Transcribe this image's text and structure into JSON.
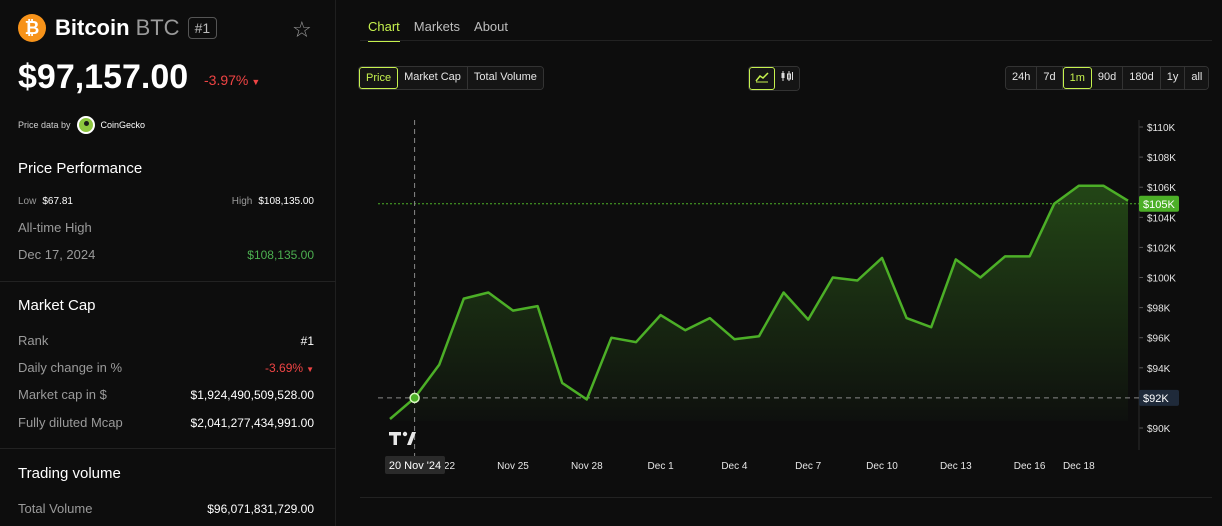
{
  "coin": {
    "logo_glyph": "₿",
    "name": "Bitcoin",
    "symbol": "BTC",
    "rank_badge": "#1",
    "price": "$97,157.00",
    "change": "-3.97%",
    "price_data_label": "Price data by",
    "price_data_source": "CoinGecko",
    "brand_color": "#f7931a"
  },
  "performance": {
    "title": "Price Performance",
    "low_label": "Low",
    "low_value": "$67.81",
    "high_label": "High",
    "high_value": "$108,135.00",
    "ath_label": "All-time High",
    "ath_date": "Dec 17, 2024",
    "ath_value": "$108,135.00"
  },
  "market_cap": {
    "title": "Market Cap",
    "rank_label": "Rank",
    "rank_value": "#1",
    "daily_change_label": "Daily change in %",
    "daily_change_value": "-3.69%",
    "mcap_label": "Market cap in $",
    "mcap_value": "$1,924,490,509,528.00",
    "fdv_label": "Fully diluted Mcap",
    "fdv_value": "$2,041,277,434,991.00"
  },
  "volume": {
    "title": "Trading volume",
    "total_label": "Total Volume",
    "total_value": "$96,071,831,729.00"
  },
  "tabs": [
    {
      "label": "Chart",
      "active": true
    },
    {
      "label": "Markets",
      "active": false
    },
    {
      "label": "About",
      "active": false
    }
  ],
  "metric_buttons": [
    {
      "label": "Price",
      "active": true
    },
    {
      "label": "Market Cap",
      "active": false
    },
    {
      "label": "Total Volume",
      "active": false
    }
  ],
  "chart_type_buttons": [
    {
      "icon": "line-chart-icon",
      "active": true
    },
    {
      "icon": "candlestick-icon",
      "active": false
    }
  ],
  "range_buttons": [
    {
      "label": "24h",
      "active": false
    },
    {
      "label": "7d",
      "active": false
    },
    {
      "label": "1m",
      "active": true
    },
    {
      "label": "90d",
      "active": false
    },
    {
      "label": "180d",
      "active": false
    },
    {
      "label": "1y",
      "active": false
    },
    {
      "label": "all",
      "active": false
    }
  ],
  "chart_data": {
    "type": "area",
    "x_start_label": "20 Nov '24",
    "x_ticks": [
      "Nov 22",
      "Nov 25",
      "Nov 28",
      "Dec 1",
      "Dec 4",
      "Dec 7",
      "Dec 10",
      "Dec 13",
      "Dec 16",
      "Dec 18"
    ],
    "y_ticks": [
      "$110K",
      "$108K",
      "$106K",
      "$104K",
      "$102K",
      "$100K",
      "$98K",
      "$96K",
      "$94K",
      "$92K",
      "$90K"
    ],
    "ylim": [
      90000,
      110000
    ],
    "current_price_label": "$105K",
    "current_price": 104900,
    "crosshair_price_label": "$92K",
    "crosshair_price": 92000,
    "values": [
      90600,
      92000,
      94200,
      98600,
      99000,
      97800,
      98100,
      93000,
      91900,
      96000,
      95700,
      97500,
      96500,
      97300,
      95900,
      96100,
      99000,
      97200,
      100000,
      99800,
      101300,
      97300,
      96700,
      101200,
      100000,
      101400,
      101400,
      104900,
      106100,
      106100,
      105100
    ],
    "line_color": "#4caf27",
    "accent_color": "#c6f24e"
  }
}
